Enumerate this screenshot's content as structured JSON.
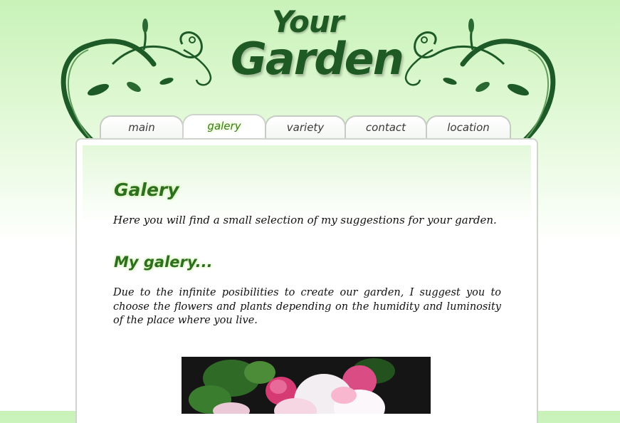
{
  "logo": {
    "line1": "Your",
    "line2": "Garden"
  },
  "nav": {
    "tabs": [
      {
        "label": "main",
        "active": false
      },
      {
        "label": "galery",
        "active": true
      },
      {
        "label": "variety",
        "active": false
      },
      {
        "label": "contact",
        "active": false
      },
      {
        "label": "location",
        "active": false
      }
    ]
  },
  "content": {
    "heading": "Galery",
    "intro": "Here you will find a small selection of my suggestions for your garden.",
    "subheading": "My galery...",
    "description": "Due to the infinite posibilities to create our garden, I suggest you to choose the flowers and plants depending on the humidity and luminosity of the place where you live."
  },
  "colors": {
    "brand_green": "#1f5a25",
    "heading_green": "#2e6e1f",
    "header_bg": "#c8f2b8"
  }
}
